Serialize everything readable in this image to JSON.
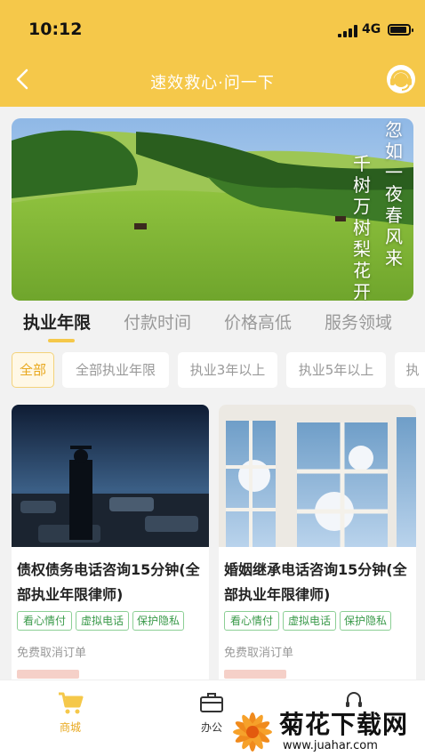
{
  "status_bar": {
    "time": "10:12",
    "network": "4G"
  },
  "header": {
    "title": "速效救心·问一下",
    "back_icon": "chevron-left-icon",
    "support_icon": "headset-icon"
  },
  "banner": {
    "poem_line_1": "忽如一夜春风来",
    "poem_line_2": "千树万树梨花开"
  },
  "tabs": [
    {
      "label": "执业年限"
    },
    {
      "label": "付款时间"
    },
    {
      "label": "价格高低"
    },
    {
      "label": "服务领域"
    }
  ],
  "filters": [
    {
      "label": "全部"
    },
    {
      "label": "全部执业年限"
    },
    {
      "label": "执业3年以上"
    },
    {
      "label": "执业5年以上"
    },
    {
      "label": "执"
    }
  ],
  "products": [
    {
      "title": "债权债务电话咨询15分钟(全部执业年限律师)",
      "tags": [
        "看心情付",
        "虚拟电话",
        "保护隐私"
      ],
      "note": "免费取消订单"
    },
    {
      "title": "婚姻继承电话咨询15分钟(全部执业年限律师)",
      "tags": [
        "看心情付",
        "虚拟电话",
        "保护隐私"
      ],
      "note": "免费取消订单"
    }
  ],
  "tabbar": [
    {
      "label": "商城",
      "icon": "cart-icon"
    },
    {
      "label": "办公",
      "icon": "briefcase-icon"
    },
    {
      "label": "",
      "icon": "headset-icon"
    }
  ],
  "watermark": {
    "title": "菊花下载网",
    "url": "www.juahar.com"
  },
  "colors": {
    "brand": "#f5c84a",
    "accent": "#e8a81e",
    "tag_green": "#3a9a4a"
  }
}
